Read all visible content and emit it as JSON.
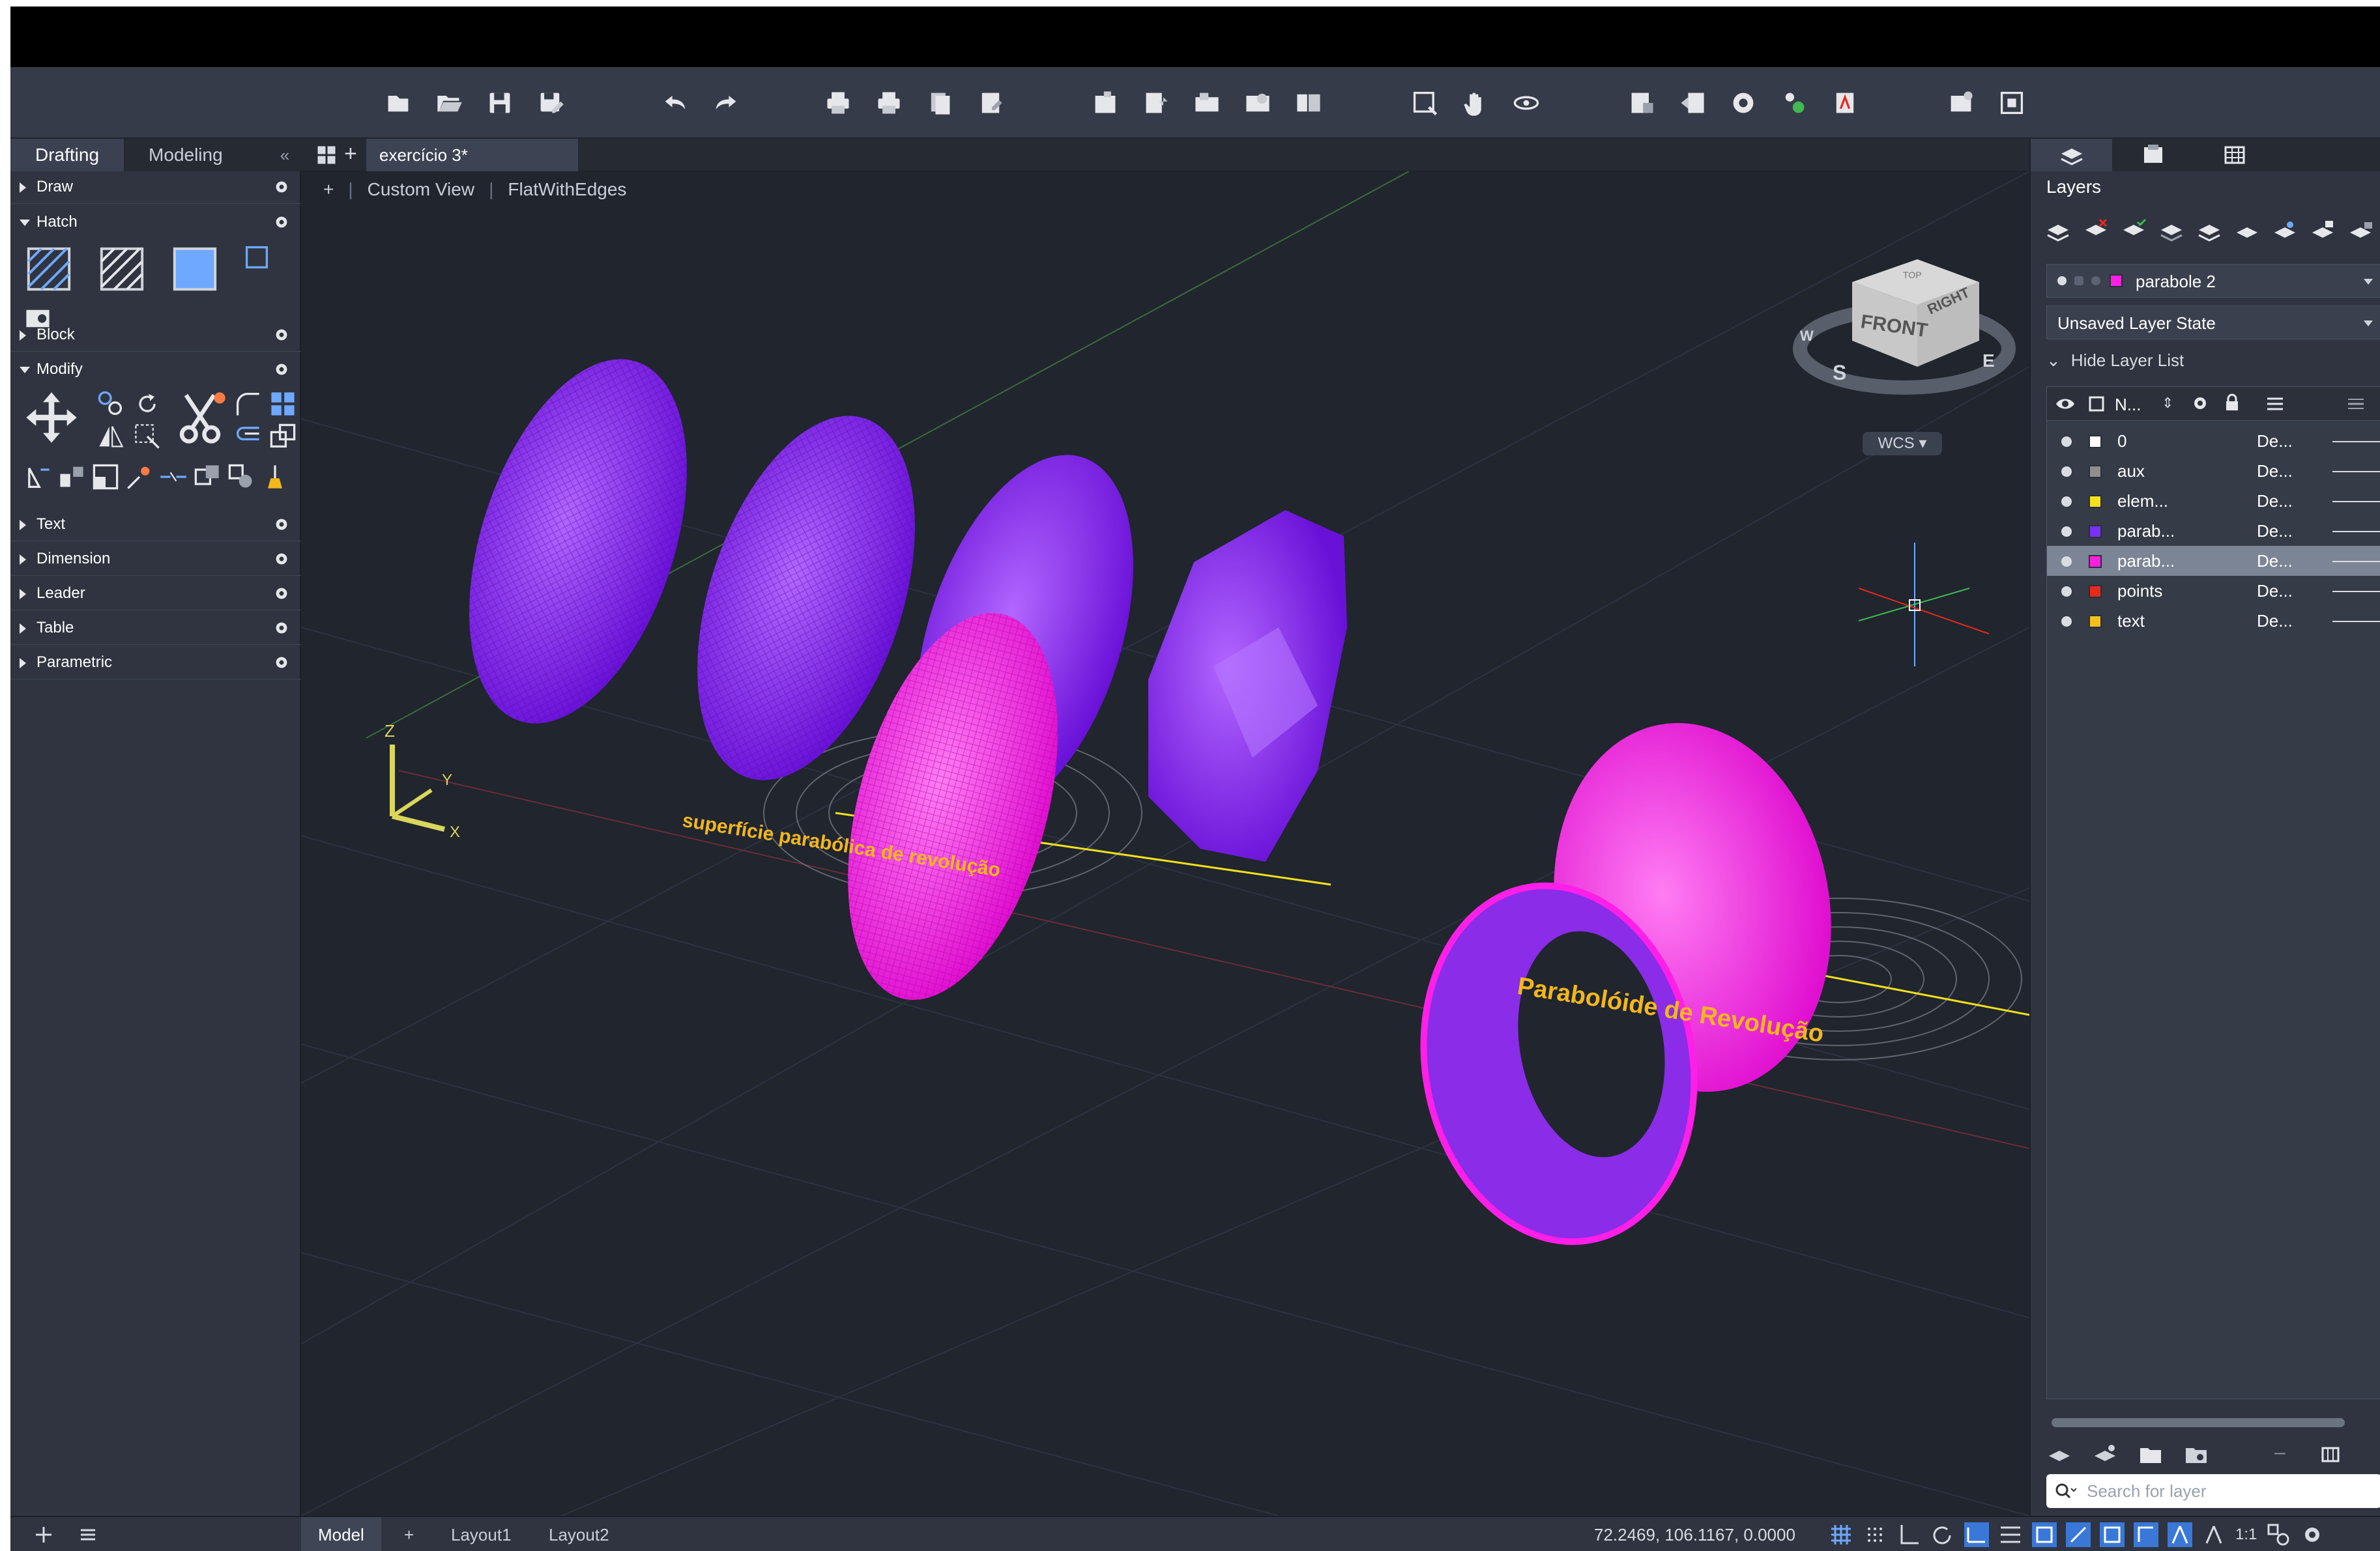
{
  "palette": {
    "tabs": [
      {
        "label": "Drafting",
        "active": true
      },
      {
        "label": "Modeling",
        "active": false
      }
    ],
    "collapse_glyph": "«",
    "sections": [
      {
        "label": "Draw",
        "open": false
      },
      {
        "label": "Hatch",
        "open": true
      },
      {
        "label": "Block",
        "open": false
      },
      {
        "label": "Modify",
        "open": true
      },
      {
        "label": "Text",
        "open": false
      },
      {
        "label": "Dimension",
        "open": false
      },
      {
        "label": "Leader",
        "open": false
      },
      {
        "label": "Table",
        "open": false
      },
      {
        "label": "Parametric",
        "open": false
      }
    ]
  },
  "document": {
    "tab_title": "exercício 3*",
    "new_tab": "+"
  },
  "viewport": {
    "controls": {
      "plus": "+",
      "view": "Custom View",
      "style": "FlatWithEdges"
    },
    "labels": {
      "surface": "superfície parabólica de revolução",
      "paraboloid": "Parabolóide de Revolução"
    },
    "viewcube": {
      "front": "FRONT",
      "right": "RIGHT",
      "top": "TOP",
      "south": "S",
      "east": "E",
      "west": "W"
    },
    "wcs": "WCS",
    "axes": {
      "x": "X",
      "y": "Y",
      "z": "Z"
    },
    "colors": {
      "purple": "#8a1ff0",
      "magenta": "#ff1fe8",
      "label": "#f3b71b"
    }
  },
  "layers": {
    "title": "Layers",
    "current_layer": "parabole 2",
    "current_color": "#ff20e0",
    "layer_state": "Unsaved Layer State",
    "hide_list": "Hide Layer List",
    "name_header": "N...",
    "rows": [
      {
        "name": "0",
        "linetype": "De...",
        "color": "#ffffff",
        "selected": false
      },
      {
        "name": "aux",
        "linetype": "De...",
        "color": "#8e8e8e",
        "selected": false
      },
      {
        "name": "elem...",
        "linetype": "De...",
        "color": "#f4e01b",
        "selected": false
      },
      {
        "name": "parab...",
        "linetype": "De...",
        "color": "#7b2ff7",
        "selected": false
      },
      {
        "name": "parab...",
        "linetype": "De...",
        "color": "#ff20e0",
        "selected": true
      },
      {
        "name": "points",
        "linetype": "De...",
        "color": "#e8291c",
        "selected": false
      },
      {
        "name": "text",
        "linetype": "De...",
        "color": "#f4c01b",
        "selected": false
      }
    ],
    "search_placeholder": "Search for layer"
  },
  "status": {
    "tabs": [
      {
        "label": "Model",
        "active": true
      },
      {
        "label": "Layout1",
        "active": false
      },
      {
        "label": "Layout2",
        "active": false
      }
    ],
    "add": "+",
    "coords": "72.2469, 106.1167, 0.0000",
    "scale": "1:1"
  }
}
